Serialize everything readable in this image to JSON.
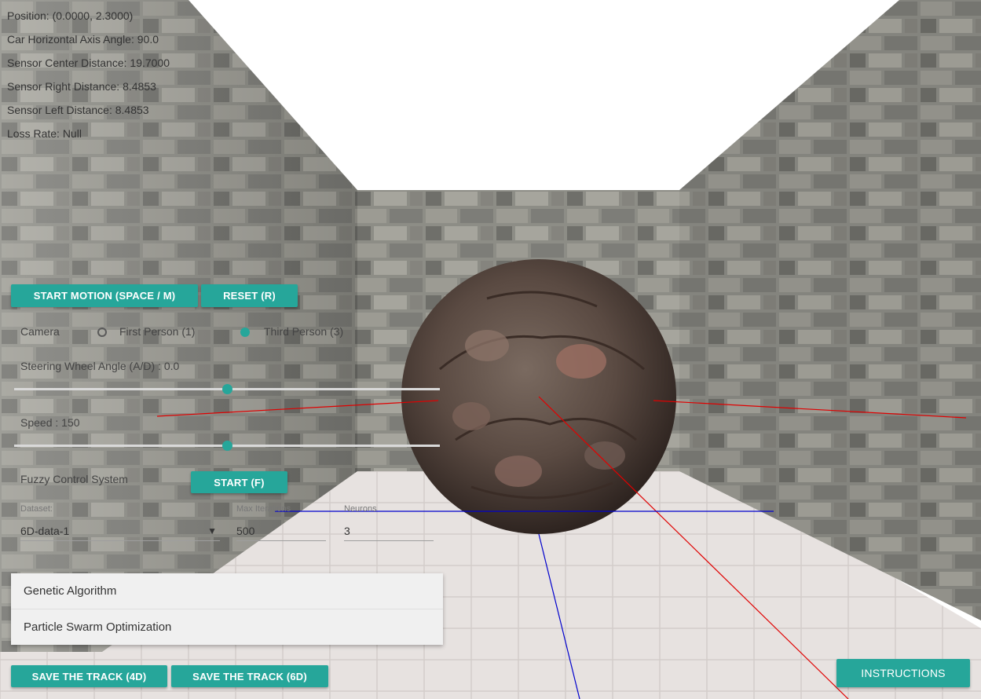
{
  "info": {
    "position": "Position: (0.0000, 2.3000)",
    "angle": "Car Horizontal Axis Angle: 90.0",
    "center": "Sensor Center Distance: 19.7000",
    "right": "Sensor Right Distance: 8.4853",
    "left": "Sensor Left Distance: 8.4853",
    "loss": "Loss Rate: Null"
  },
  "controls": {
    "start_motion": "START MOTION (SPACE / M)",
    "reset": "RESET (R)",
    "camera_label": "Camera",
    "camera_options": [
      "First Person (1)",
      "Third Person (3)"
    ],
    "camera_selected": "Third Person (3)",
    "steering_label": "Steering Wheel Angle (A/D) : 0.0",
    "steering_level": 0.5,
    "speed_label": "Speed : 150",
    "speed_level": 0.5,
    "fuzzy_label": "Fuzzy Control System",
    "fuzzy_start": "START (F)",
    "dataset_label": "Dataset:",
    "dataset_value": "6D-data-1",
    "iterations_label": "Max Iterations",
    "iterations_value": "500",
    "neurons_label": "Neurons",
    "neurons_value": "3",
    "algorithm_options": [
      "Genetic Algorithm",
      "Particle Swarm Optimization"
    ],
    "save_4d": "SAVE THE TRACK (4D)",
    "save_6d": "SAVE THE TRACK (6D)",
    "instructions": "INSTRUCTIONS"
  },
  "colors": {
    "accent": "#26a69a",
    "sensor_line": "#e00000",
    "axis_line": "#0000cc"
  }
}
